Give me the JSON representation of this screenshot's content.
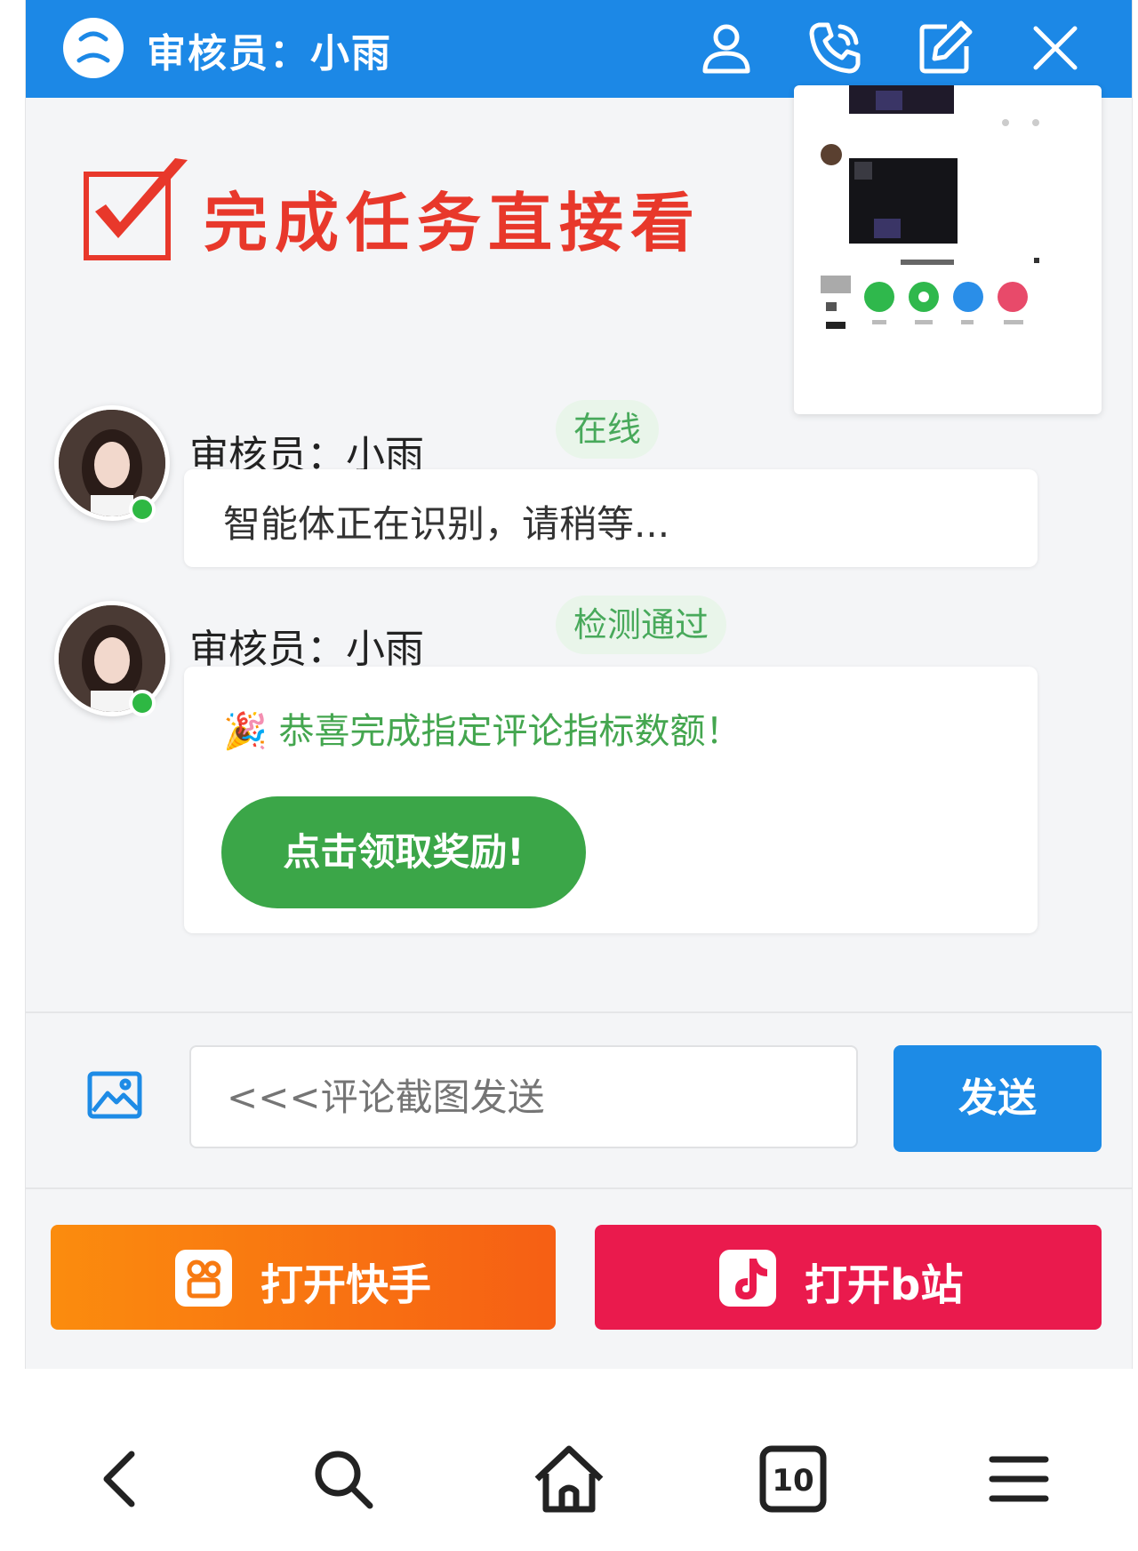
{
  "header": {
    "title": "审核员：小雨"
  },
  "banner": {
    "text": "完成任务直接看"
  },
  "messages": [
    {
      "sender": "审核员：小雨",
      "tag": "在线",
      "text": "智能体正在识别，请稍等..."
    },
    {
      "sender": "审核员：小雨",
      "tag": "检测通过",
      "emoji": "🎉",
      "text": "恭喜完成指定评论指标数额！",
      "button": "点击领取奖励!"
    }
  ],
  "input": {
    "placeholder": "<<<评论截图发送",
    "send_label": "发送"
  },
  "apps": {
    "kuaishou_label": "打开快手",
    "bilibili_label": "打开b站"
  },
  "nav": {
    "tabs_count": "10"
  },
  "colors": {
    "header": "#1c88e6",
    "online": "#2eb843",
    "reward": "#3ba648",
    "kuaishou": "#f96d10",
    "bilibili": "#ea1a4d"
  }
}
